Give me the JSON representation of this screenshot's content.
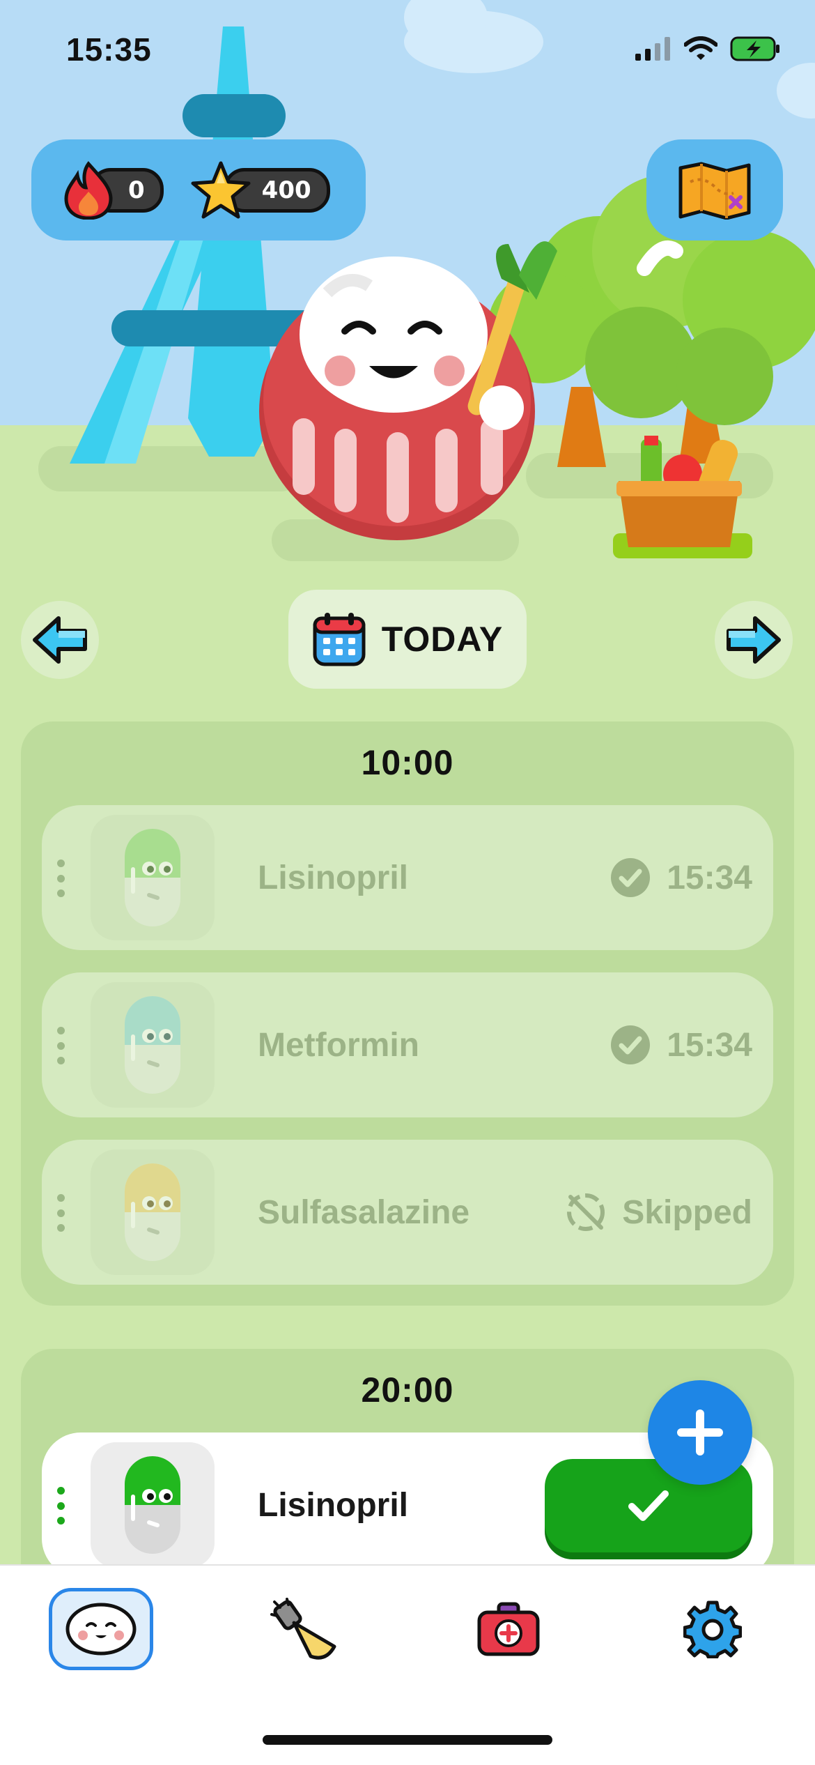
{
  "status_bar": {
    "time": "15:35"
  },
  "header": {
    "streak": "0",
    "stars": "400"
  },
  "day_nav": {
    "label": "TODAY"
  },
  "schedule": [
    {
      "time": "10:00",
      "items": [
        {
          "name": "Lisinopril",
          "status": "15:34",
          "state": "taken",
          "pill_color": "#7fcd5e"
        },
        {
          "name": "Metformin",
          "status": "15:34",
          "state": "taken",
          "pill_color": "#7ecfb9"
        },
        {
          "name": "Sulfasalazine",
          "status": "Skipped",
          "state": "skipped",
          "pill_color": "#e0d87a"
        }
      ]
    },
    {
      "time": "20:00",
      "items": [
        {
          "name": "Lisinopril",
          "state": "pending",
          "pill_color": "#22b81f"
        }
      ]
    }
  ],
  "tabs": [
    {
      "icon": "daruma-face-icon",
      "selected": true
    },
    {
      "icon": "flashlight-icon",
      "selected": false
    },
    {
      "icon": "first-aid-kit-icon",
      "selected": false
    },
    {
      "icon": "gear-icon",
      "selected": false
    }
  ],
  "colors": {
    "accent_green": "#16a31a",
    "accent_blue": "#1e86e6",
    "sky": "#b7dcf6",
    "ground": "#cde8ab"
  }
}
